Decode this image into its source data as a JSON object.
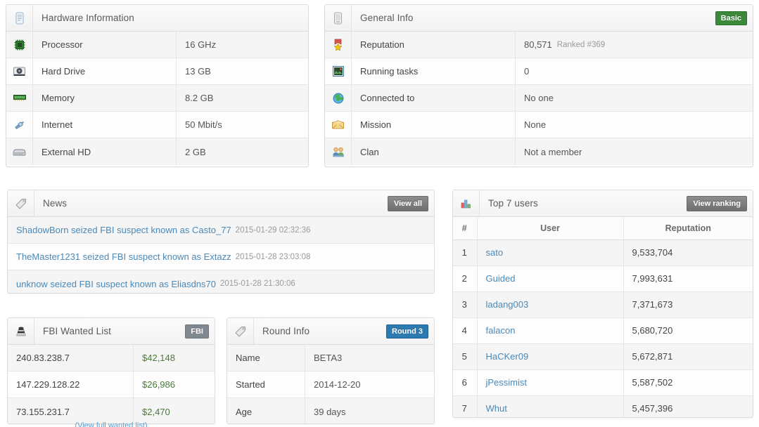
{
  "colors": {
    "link": "#4a89b8",
    "badge_basic": "#3a8a3a",
    "badge_round": "#2b7bb0",
    "badge_fbi": "#808890",
    "button_gray": "#7d7d7d",
    "money_green": "#4a7a3a",
    "panel_border": "#dcdcdc",
    "row_shade": "#f5f5f5"
  },
  "hardware_panel": {
    "title": "Hardware Information",
    "icon": "server-icon",
    "rows": [
      {
        "icon": "processor-chip-icon",
        "label": "Processor",
        "value": "16 GHz"
      },
      {
        "icon": "hard-drive-icon",
        "label": "Hard Drive",
        "value": "13 GB"
      },
      {
        "icon": "memory-ram-icon",
        "label": "Memory",
        "value": "8.2 GB"
      },
      {
        "icon": "network-plug-icon",
        "label": "Internet",
        "value": "50 Mbit/s"
      },
      {
        "icon": "external-hd-icon",
        "label": "External HD",
        "value": "2 GB"
      }
    ]
  },
  "general_panel": {
    "title": "General Info",
    "icon": "device-icon",
    "badge": "Basic",
    "rows": [
      {
        "icon": "award-ribbon-icon",
        "label": "Reputation",
        "value": "80,571",
        "note": "Ranked #369"
      },
      {
        "icon": "tasks-image-icon",
        "label": "Running tasks",
        "value": "0",
        "note": ""
      },
      {
        "icon": "globe-icon",
        "label": "Connected to",
        "value": "No one",
        "note": ""
      },
      {
        "icon": "envelope-icon",
        "label": "Mission",
        "value": "None",
        "note": ""
      },
      {
        "icon": "clan-people-icon",
        "label": "Clan",
        "value": "Not a member",
        "note": ""
      }
    ]
  },
  "news_panel": {
    "title": "News",
    "icon": "tag-icon",
    "button": "View all",
    "items": [
      {
        "text": "ShadowBorn seized FBI suspect known as Casto_77",
        "date": "2015-01-29 02:32:36"
      },
      {
        "text": "TheMaster1231 seized FBI suspect known as Extazz",
        "date": "2015-01-28 23:03:08"
      },
      {
        "text": "unknow seized FBI suspect known as Eliasdns70",
        "date": "2015-01-28 21:30:06"
      }
    ]
  },
  "top_users_panel": {
    "title": "Top 7 users",
    "icon": "bar-chart-icon",
    "button": "View ranking",
    "columns": [
      "#",
      "User",
      "Reputation"
    ],
    "rows": [
      {
        "rank": "1",
        "user": "sato",
        "reputation": "9,533,704"
      },
      {
        "rank": "2",
        "user": "Guided",
        "reputation": "7,993,631"
      },
      {
        "rank": "3",
        "user": "ladang003",
        "reputation": "7,371,673"
      },
      {
        "rank": "4",
        "user": "falacon",
        "reputation": "5,680,720"
      },
      {
        "rank": "5",
        "user": "HaCKer09",
        "reputation": "5,672,871"
      },
      {
        "rank": "6",
        "user": "jPessimist",
        "reputation": "5,587,502"
      },
      {
        "rank": "7",
        "user": "Whut",
        "reputation": "5,457,396"
      }
    ]
  },
  "fbi_panel": {
    "title": "FBI Wanted List",
    "icon": "police-icon",
    "badge": "FBI",
    "footer": "(View full wanted list)",
    "rows": [
      {
        "ip": "240.83.238.7",
        "amount": "$42,148"
      },
      {
        "ip": "147.229.128.22",
        "amount": "$26,986"
      },
      {
        "ip": "73.155.231.7",
        "amount": "$2,470"
      }
    ]
  },
  "round_panel": {
    "title": "Round Info",
    "icon": "tag-icon",
    "badge": "Round 3",
    "rows": [
      {
        "label": "Name",
        "value": "BETA3"
      },
      {
        "label": "Started",
        "value": "2014-12-20"
      },
      {
        "label": "Age",
        "value": "39 days"
      }
    ]
  }
}
